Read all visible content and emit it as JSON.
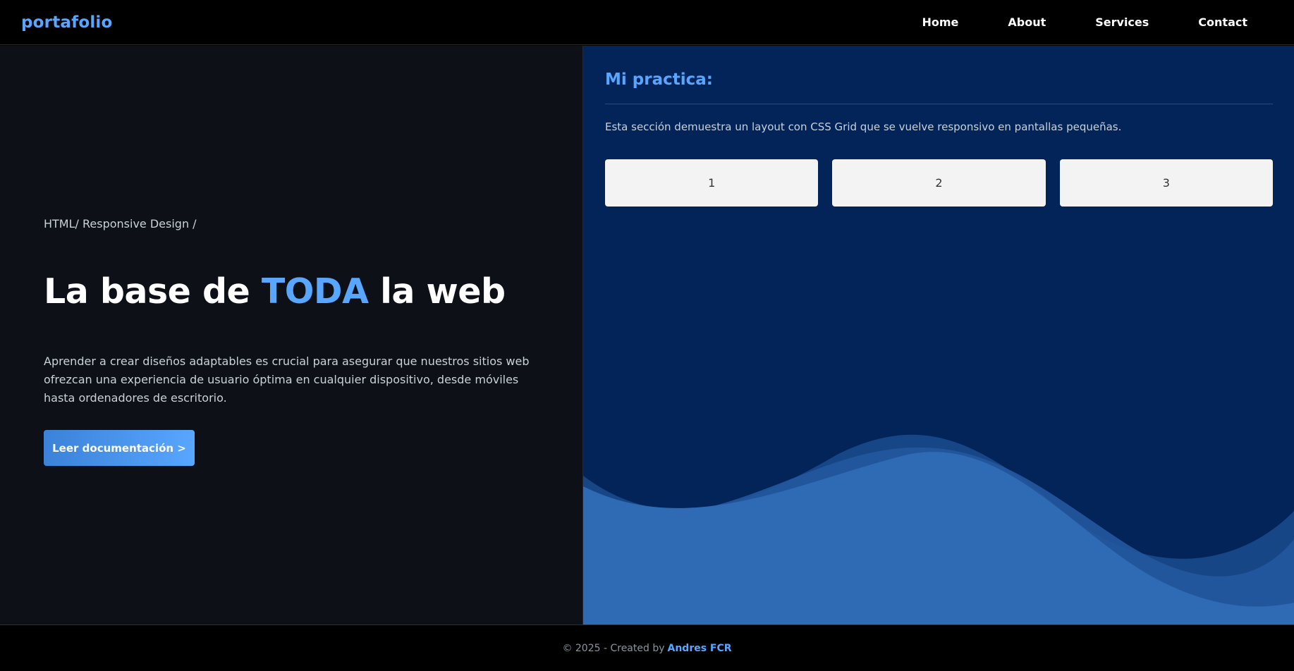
{
  "header": {
    "logo": "portafolio",
    "nav": [
      "Home",
      "About",
      "Services",
      "Contact"
    ]
  },
  "hero": {
    "breadcrumb": "HTML/ Responsive Design /",
    "title_prefix": "La base de ",
    "title_accent": "TODA",
    "title_suffix": " la web",
    "description": "Aprender a crear diseños adaptables es crucial para asegurar que nuestros sitios web ofrezcan una experiencia de usuario óptima en cualquier dispositivo, desde móviles hasta ordenadores de escritorio.",
    "cta_label": "Leer documentación >"
  },
  "practice": {
    "title": "Mi practica:",
    "description": "Esta sección demuestra un layout con CSS Grid que se vuelve responsivo en pantallas pequeñas.",
    "grid_items": [
      "1",
      "2",
      "3"
    ]
  },
  "footer": {
    "text": "© 2025 - Created by",
    "author": "Andres FCR"
  },
  "colors": {
    "accent": "#58a6ff",
    "left_bg": "#0d1117",
    "right_bg": "#022459",
    "wave_light": "#2f6ab4",
    "wave_mid": "#1a4a8c"
  }
}
